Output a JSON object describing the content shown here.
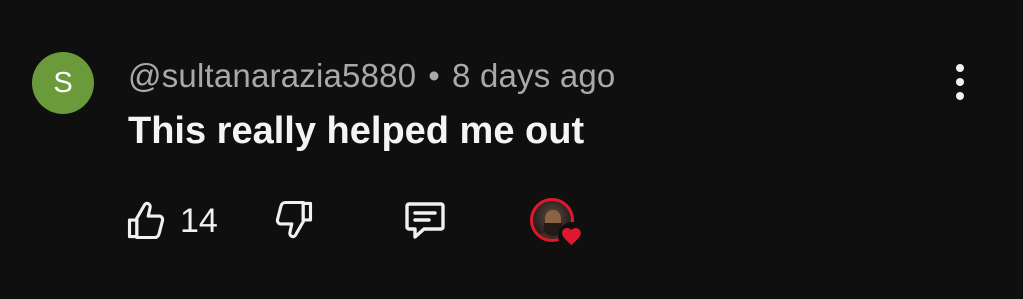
{
  "comment": {
    "avatar_letter": "S",
    "avatar_color": "#6a9a3a",
    "username": "@sultanarazia5880",
    "separator": "•",
    "timestamp": "8 days ago",
    "text": "This really helped me out",
    "more_icon": "more-vertical-icon"
  },
  "actions": {
    "like_icon": "thumbs-up-icon",
    "like_count": "14",
    "dislike_icon": "thumbs-down-icon",
    "reply_icon": "reply-comment-icon",
    "creator_heart_icon": "heart-icon",
    "heart_color": "#e0182d"
  }
}
